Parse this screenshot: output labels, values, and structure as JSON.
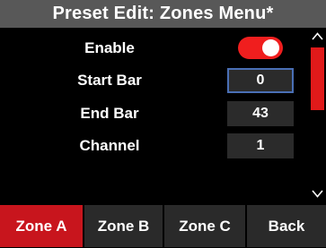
{
  "header": {
    "title": "Preset Edit: Zones Menu*"
  },
  "settings": {
    "enable": {
      "label": "Enable",
      "on": true
    },
    "start_bar": {
      "label": "Start Bar",
      "value": "0"
    },
    "end_bar": {
      "label": "End Bar",
      "value": "43"
    },
    "channel": {
      "label": "Channel",
      "value": "1"
    }
  },
  "scrollbar": {
    "up_icon": "chevron-up-icon",
    "down_icon": "chevron-down-icon"
  },
  "tabs": [
    {
      "label": "Zone A",
      "active": true
    },
    {
      "label": "Zone B",
      "active": false
    },
    {
      "label": "Zone C",
      "active": false
    },
    {
      "label": "Back",
      "active": false
    }
  ],
  "colors": {
    "accent_red": "#e01a1a",
    "title_bar": "#585858",
    "value_box": "#2b2b2b",
    "selected_border": "#4a6fb5"
  }
}
